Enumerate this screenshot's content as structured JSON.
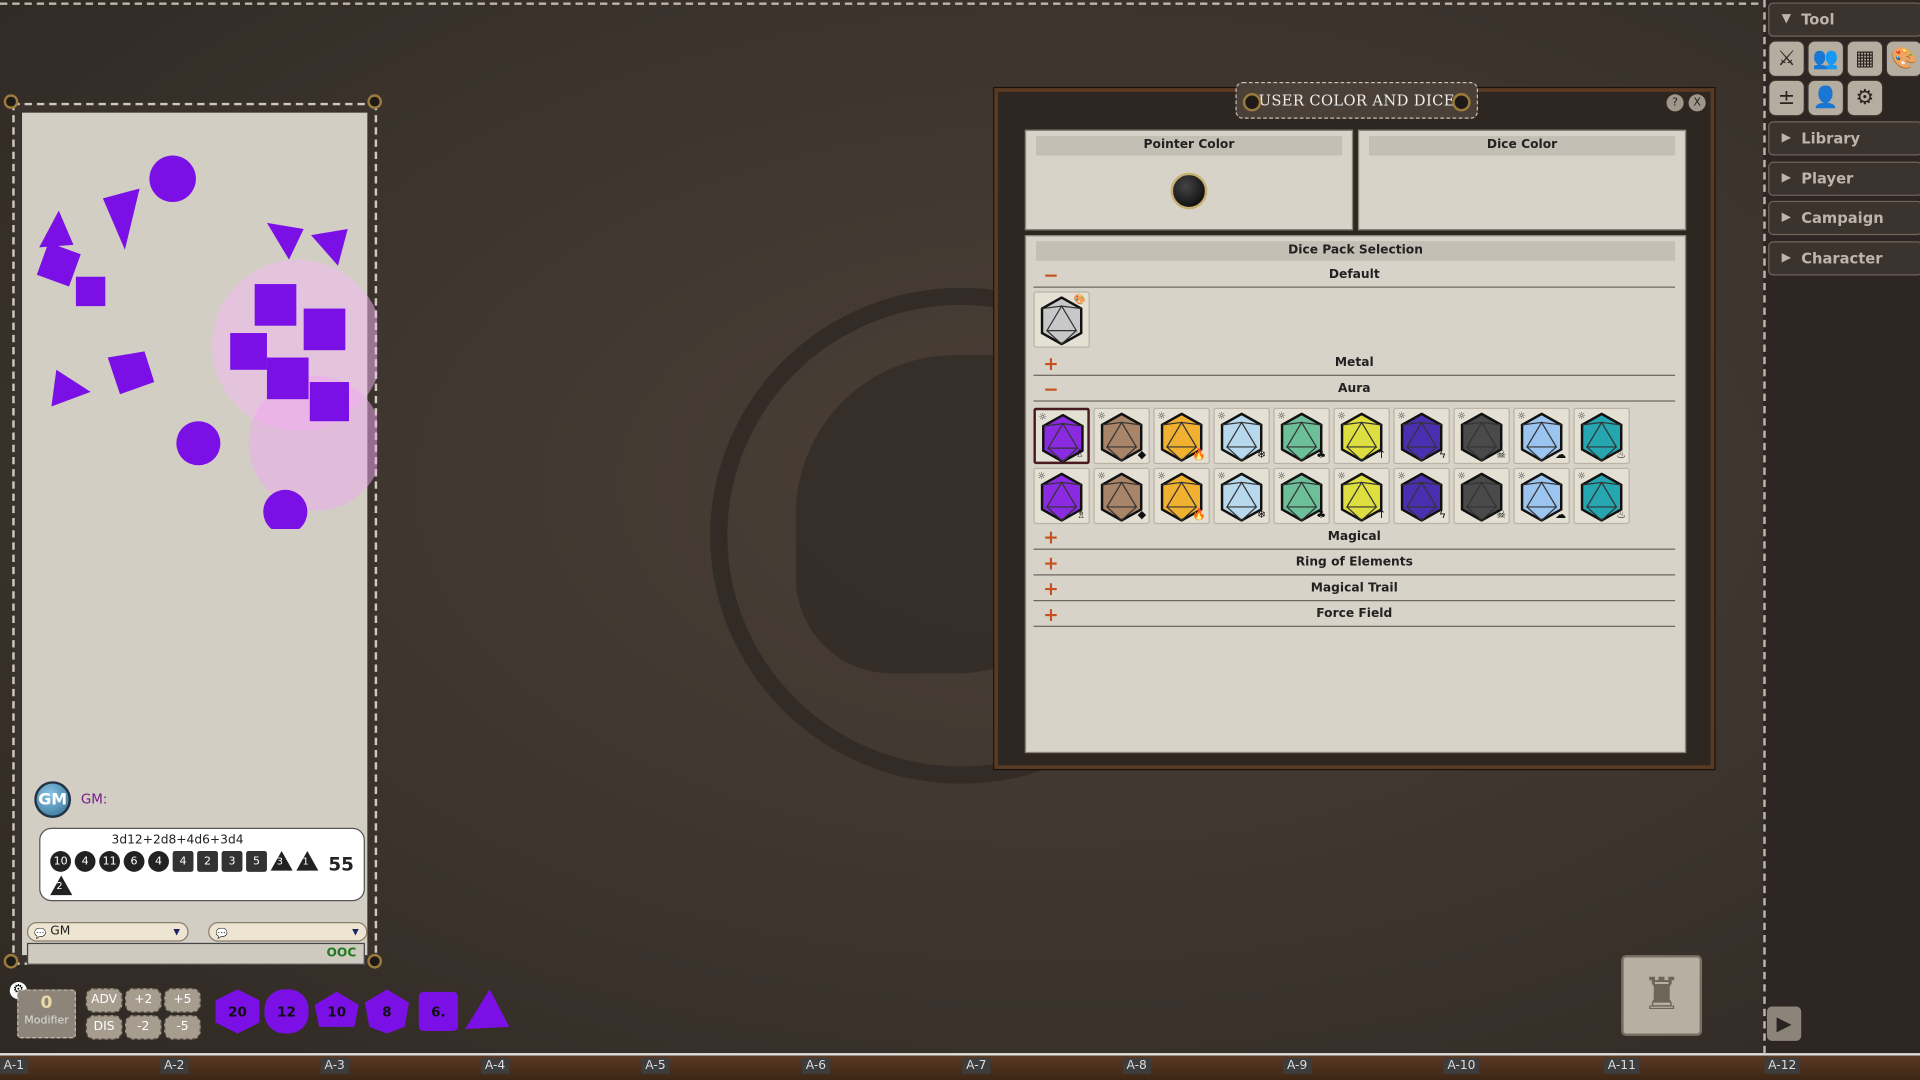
{
  "chat": {
    "speaker_avatar": "GM",
    "speaker_label": "GM:",
    "roll": {
      "expression": "3d12+2d8+4d6+3d4",
      "results": [
        {
          "v": "10",
          "shape": "c"
        },
        {
          "v": "4",
          "shape": "c"
        },
        {
          "v": "11",
          "shape": "c"
        },
        {
          "v": "6",
          "shape": "c"
        },
        {
          "v": "4",
          "shape": "c"
        },
        {
          "v": "4",
          "shape": "s"
        },
        {
          "v": "2",
          "shape": "s"
        },
        {
          "v": "3",
          "shape": "s"
        },
        {
          "v": "5",
          "shape": "s"
        },
        {
          "v": "3",
          "shape": "t"
        },
        {
          "v": "1",
          "shape": "t"
        },
        {
          "v": "2",
          "shape": "t"
        }
      ],
      "total": "55"
    },
    "identity_select": "GM",
    "language_select": "",
    "input_value": "",
    "ooc_label": "OOC"
  },
  "dicebar": {
    "modifier_value": "0",
    "modifier_label": "Modifier",
    "buttons": [
      "ADV",
      "+2",
      "+5",
      "DIS",
      "-2",
      "-5"
    ],
    "dice": [
      {
        "label": "20",
        "type": "d20"
      },
      {
        "label": "12",
        "type": "d12"
      },
      {
        "label": "10",
        "type": "d10"
      },
      {
        "label": "8",
        "type": "d8"
      },
      {
        "label": "6.",
        "type": "d6"
      },
      {
        "label": "",
        "type": "d4"
      }
    ],
    "dice_color": "#7a10e6"
  },
  "grid_labels": [
    "A-1",
    "A-2",
    "A-3",
    "A-4",
    "A-5",
    "A-6",
    "A-7",
    "A-8",
    "A-9",
    "A-10",
    "A-11",
    "A-12"
  ],
  "sidebar": {
    "sections": [
      {
        "label": "Tool",
        "expanded": true
      },
      {
        "label": "Library",
        "expanded": false
      },
      {
        "label": "Player",
        "expanded": false
      },
      {
        "label": "Campaign",
        "expanded": false
      },
      {
        "label": "Character",
        "expanded": false
      }
    ],
    "tool_icons": [
      "combat-tracker-icon",
      "party-sheet-icon",
      "calendar-icon",
      "colors-icon",
      "modifiers-icon",
      "effects-icon",
      "options-icon"
    ]
  },
  "dialog": {
    "title": "USER COLOR AND DICE",
    "help": "?",
    "close": "X",
    "pointer_color_label": "Pointer Color",
    "pointer_color": "#000000",
    "dice_color_label": "Dice Color",
    "dice_pack_label": "Dice Pack Selection",
    "groups": [
      {
        "label": "Default",
        "expanded": true
      },
      {
        "label": "Metal",
        "expanded": false
      },
      {
        "label": "Aura",
        "expanded": true
      },
      {
        "label": "Magical",
        "expanded": false
      },
      {
        "label": "Ring of Elements",
        "expanded": false
      },
      {
        "label": "Magical Trail",
        "expanded": false
      },
      {
        "label": "Force Field",
        "expanded": false
      }
    ],
    "default_pack": {
      "color": "#c8c8c8"
    },
    "aura_packs": [
      {
        "color": "#8a2be2",
        "mark": "♗"
      },
      {
        "color": "#a88468",
        "mark": "◆"
      },
      {
        "color": "#f0b030",
        "mark": "🔥"
      },
      {
        "color": "#b8d8ee",
        "mark": "❄"
      },
      {
        "color": "#6cbf98",
        "mark": "♣"
      },
      {
        "color": "#dede40",
        "mark": "↑"
      },
      {
        "color": "#4a30b0",
        "mark": "ϟ"
      },
      {
        "color": "#4a4a4a",
        "mark": "☠"
      },
      {
        "color": "#9cc4f0",
        "mark": "☁"
      },
      {
        "color": "#25a6b0",
        "mark": "♨"
      }
    ],
    "selected_pack": 0
  }
}
